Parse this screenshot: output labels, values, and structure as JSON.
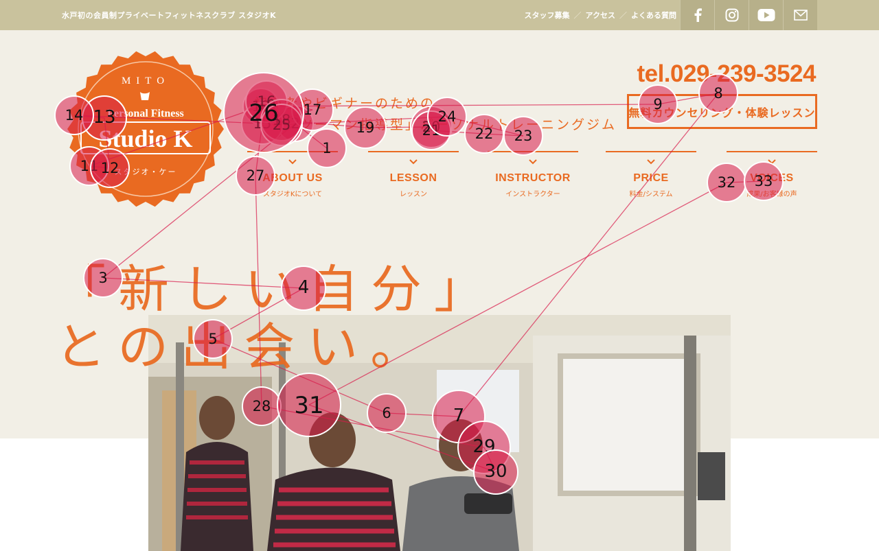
{
  "topbar": {
    "tagline": "水戸初の会員制プライベートフィットネスクラブ スタジオK",
    "links": [
      {
        "label": "スタッフ募集"
      },
      {
        "label": "アクセス"
      },
      {
        "label": "よくある質問"
      }
    ],
    "social": [
      {
        "name": "facebook-icon"
      },
      {
        "name": "instagram-icon"
      },
      {
        "name": "youtube-icon"
      },
      {
        "name": "mail-icon"
      }
    ]
  },
  "logo": {
    "top": "MITO",
    "middle": "Personal Fitness",
    "brand": "Studio K",
    "kana": "スタジオ・ケー"
  },
  "catch": {
    "line1": "初心者やビギナーのための",
    "line2": "「マンツーマン指導型」パーソナルトレーニングジム"
  },
  "contact": {
    "tel": "tel.029-239-3524",
    "cta": "無料カウンセリング・体験レッスン"
  },
  "nav": [
    {
      "en": "ABOUT US",
      "jp": "スタジオKについて"
    },
    {
      "en": "LESSON",
      "jp": "レッスン"
    },
    {
      "en": "INSTRUCTOR",
      "jp": "インストラクター"
    },
    {
      "en": "PRICE",
      "jp": "料金/システム"
    },
    {
      "en": "VOICES",
      "jp": "成果/お客様の声"
    }
  ],
  "hero": {
    "line1": "「新しい自分」",
    "line2": "との出会い。"
  },
  "colors": {
    "accent": "#e96a21",
    "topbar": "#c9c29d",
    "hero_bg": "#f2efe6",
    "fixation": "#d81b4a"
  },
  "fixations": [
    {
      "n": "1"
    },
    {
      "n": "2"
    },
    {
      "n": "3"
    },
    {
      "n": "4"
    },
    {
      "n": "5"
    },
    {
      "n": "6"
    },
    {
      "n": "7"
    },
    {
      "n": "8"
    },
    {
      "n": "9"
    },
    {
      "n": "10"
    },
    {
      "n": "11"
    },
    {
      "n": "12"
    },
    {
      "n": "13"
    },
    {
      "n": "14"
    },
    {
      "n": "15"
    },
    {
      "n": "16"
    },
    {
      "n": "17"
    },
    {
      "n": "18"
    },
    {
      "n": "19"
    },
    {
      "n": "20"
    },
    {
      "n": "21"
    },
    {
      "n": "22"
    },
    {
      "n": "23"
    },
    {
      "n": "24"
    },
    {
      "n": "25"
    },
    {
      "n": "26"
    },
    {
      "n": "27"
    },
    {
      "n": "28"
    },
    {
      "n": "29"
    },
    {
      "n": "30"
    },
    {
      "n": "31"
    },
    {
      "n": "32"
    },
    {
      "n": "33"
    }
  ]
}
